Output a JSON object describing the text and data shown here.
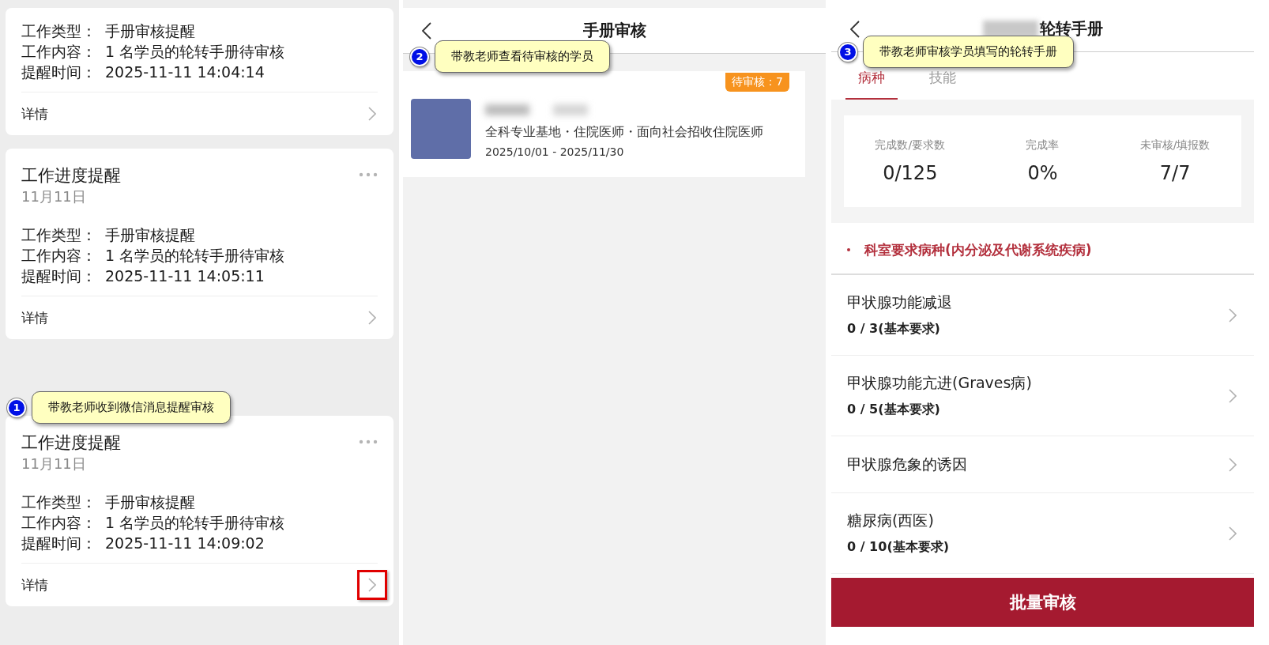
{
  "chat_panel": {
    "cards": [
      {
        "fields": [
          {
            "label": "工作类型：",
            "value": "手册审核提醒"
          },
          {
            "label": "工作内容：",
            "value": "1 名学员的轮转手册待审核"
          },
          {
            "label": "提醒时间：",
            "value": "2025-11-11 14:04:14"
          }
        ],
        "footer": "详情",
        "highlighted": false
      },
      {
        "title": "工作进度提醒",
        "date": "11月11日",
        "fields": [
          {
            "label": "工作类型：",
            "value": "手册审核提醒"
          },
          {
            "label": "工作内容：",
            "value": "1 名学员的轮转手册待审核"
          },
          {
            "label": "提醒时间：",
            "value": "2025-11-11 14:05:11"
          }
        ],
        "footer": "详情",
        "highlighted": false
      },
      {
        "title": "工作进度提醒",
        "date": "11月11日",
        "fields": [
          {
            "label": "工作类型：",
            "value": "手册审核提醒"
          },
          {
            "label": "工作内容：",
            "value": "1 名学员的轮转手册待审核"
          },
          {
            "label": "提醒时间：",
            "value": "2025-11-11 14:09:02"
          }
        ],
        "footer": "详情",
        "highlighted": true
      }
    ],
    "callout": {
      "number": "1",
      "text": "带教老师收到微信消息提醒审核"
    }
  },
  "review_panel": {
    "title": "手册审核",
    "callout": {
      "number": "2",
      "text": "带教老师查看待审核的学员"
    },
    "students": [
      {
        "badge": "待审核：7",
        "info": "全科专业基地・住院医师・面向社会招收住院医师",
        "period": "2025/10/01 - 2025/11/30"
      }
    ]
  },
  "handbook_panel": {
    "title": "轮转手册",
    "callout": {
      "number": "3",
      "text": "带教老师审核学员填写的轮转手册"
    },
    "tabs": [
      {
        "label": "病种",
        "selected": true
      },
      {
        "label": "技能",
        "selected": false
      }
    ],
    "stats": [
      {
        "label": "完成数/要求数",
        "value": "0/125"
      },
      {
        "label": "完成率",
        "value": "0%"
      },
      {
        "label": "未审核/填报数",
        "value": "7/7"
      }
    ],
    "section": "科室要求病种(内分泌及代谢系统疾病)",
    "items": [
      {
        "name": "甲状腺功能减退",
        "count": "0 / 3(基本要求)"
      },
      {
        "name": "甲状腺功能亢进(Graves病)",
        "count": "0 / 5(基本要求)"
      },
      {
        "name": "甲状腺危象的诱因"
      },
      {
        "name": "糖尿病(西医)",
        "count": "0 / 10(基本要求)"
      }
    ],
    "button": "批量审核"
  }
}
